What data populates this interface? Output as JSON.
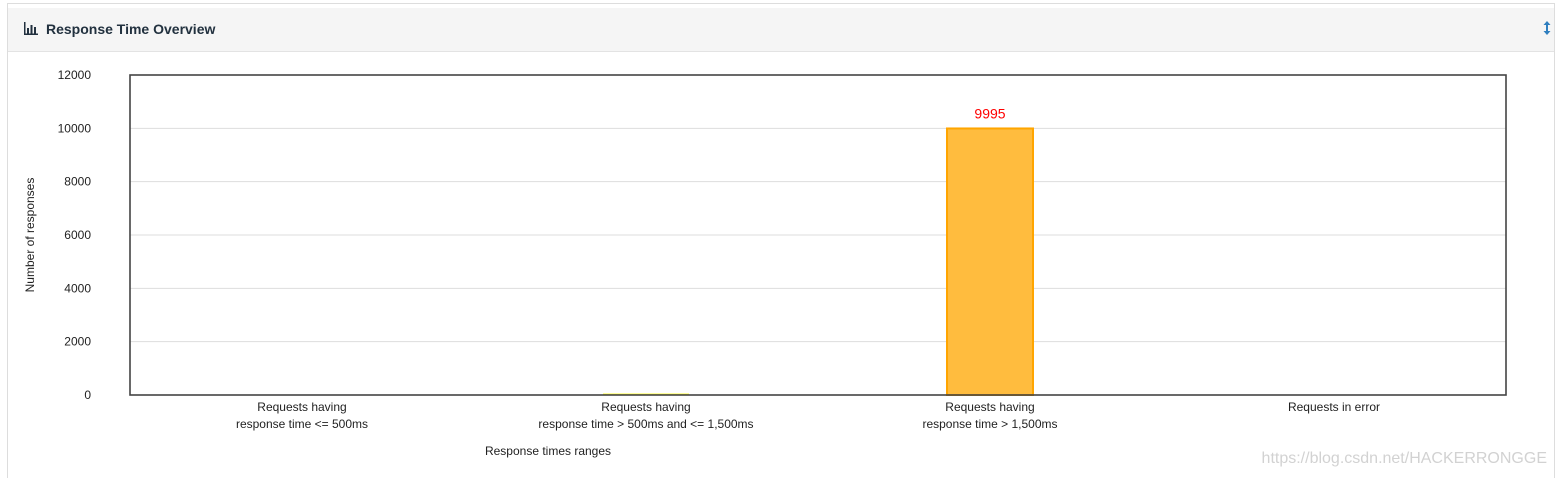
{
  "panel": {
    "title": "Response Time Overview",
    "icons": {
      "title_icon": "bar-chart-icon",
      "toggle_icon": "collapse-toggle-icon"
    }
  },
  "chart_data": {
    "type": "bar",
    "xlabel": "Response times ranges",
    "ylabel": "Number of responses",
    "ylim": [
      0,
      12000
    ],
    "yticks": [
      0,
      2000,
      4000,
      6000,
      8000,
      10000,
      12000
    ],
    "grid": true,
    "categories": [
      [
        "Requests having",
        "response time <= 500ms"
      ],
      [
        "Requests having",
        "response time > 500ms and <= 1,500ms"
      ],
      [
        "Requests having",
        "response time > 1,500ms"
      ],
      [
        "Requests in error"
      ]
    ],
    "values": [
      0,
      5,
      9995,
      0
    ],
    "bar_colors": [
      "#9ACD32",
      "#FFFF33",
      "#FFBC3E",
      "#FF5555"
    ],
    "data_labels": [
      "",
      "",
      "9995",
      ""
    ],
    "data_label_color": "#ff0000"
  },
  "watermark": "https://blog.csdn.net/HACKERRONGGE"
}
